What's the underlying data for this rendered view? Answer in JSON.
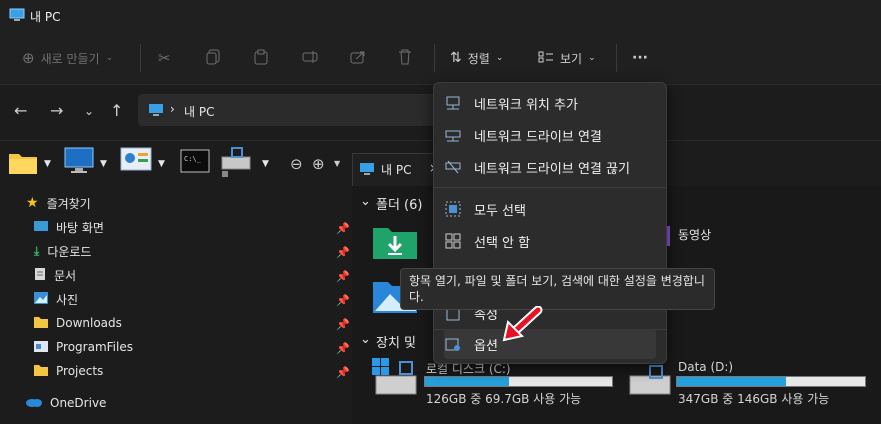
{
  "window": {
    "title": "내 PC"
  },
  "commandbar": {
    "new_label": "새로 만들기",
    "sort_label": "정렬",
    "view_label": "보기",
    "more_label": "···"
  },
  "address": {
    "location": "내 PC"
  },
  "tab": {
    "label": "내 PC"
  },
  "sidebar": {
    "favorites": "즐겨찾기",
    "items": [
      {
        "label": "바탕 화면"
      },
      {
        "label": "다운로드"
      },
      {
        "label": "문서"
      },
      {
        "label": "사진"
      },
      {
        "label": "Downloads"
      },
      {
        "label": "ProgramFiles"
      },
      {
        "label": "Projects"
      }
    ],
    "onedrive": "OneDrive"
  },
  "content": {
    "folders_header": "폴더 (6)",
    "devices_header": "장치 및",
    "folder_video": "동영상",
    "drives": [
      {
        "name": "로컬 디스크 (C:)",
        "space": "126GB 중 69.7GB 사용 가능",
        "used": 0.45
      },
      {
        "name": "Data (D:)",
        "space": "347GB 중 146GB 사용 가능",
        "used": 0.58
      }
    ]
  },
  "menu": {
    "items": [
      {
        "label": "네트워크 위치 추가",
        "icon": "network-location-icon"
      },
      {
        "label": "네트워크 드라이브 연결",
        "icon": "map-drive-icon"
      },
      {
        "label": "네트워크 드라이브 연결 끊기",
        "icon": "disconnect-drive-icon"
      },
      {
        "label": "모두 선택",
        "icon": "select-all-icon"
      },
      {
        "label": "선택 안 함",
        "icon": "select-none-icon"
      },
      {
        "label": "속성",
        "icon": "properties-icon"
      },
      {
        "label": "옵션",
        "icon": "options-icon"
      }
    ]
  },
  "tooltip": {
    "text": "항목 열기, 파일 및 폴더 보기, 검색에 대한 설정을 변경합니다."
  },
  "colors": {
    "accent": "#26a0da",
    "background": "#1c1c1c",
    "menu": "#2c2c2c",
    "arrow": "#e81123"
  }
}
